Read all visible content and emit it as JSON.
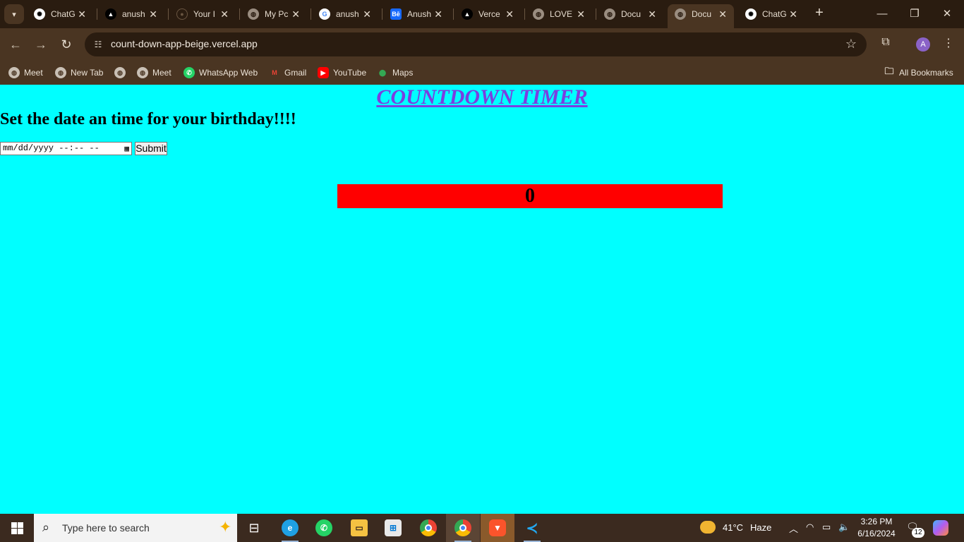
{
  "browser": {
    "tabs": [
      {
        "title": "ChatG",
        "icon": "chatgpt-icon",
        "color": "#ffffff"
      },
      {
        "title": "anush",
        "icon": "vercel-icon",
        "color": "#000000"
      },
      {
        "title": "Your I",
        "icon": "github-icon",
        "color": "#2a1c10"
      },
      {
        "title": "My Pc",
        "icon": "globe-icon",
        "color": "#9a8d80"
      },
      {
        "title": "anush",
        "icon": "google-icon",
        "color": "#ffffff"
      },
      {
        "title": "Anush",
        "icon": "behance-icon",
        "color": "#1769ff"
      },
      {
        "title": "Verce",
        "icon": "vercel-icon",
        "color": "#000000"
      },
      {
        "title": "LOVE",
        "icon": "globe-icon",
        "color": "#9a8d80"
      },
      {
        "title": "Docu",
        "icon": "globe-icon",
        "color": "#9a8d80"
      },
      {
        "title": "Docu",
        "icon": "globe-icon",
        "color": "#9a8d80"
      },
      {
        "title": "ChatG",
        "icon": "chatgpt-icon",
        "color": "#ffffff"
      }
    ],
    "active_tab_index": 9,
    "url": "count-down-app-beige.vercel.app",
    "avatar_letter": "A",
    "bookmarks": [
      {
        "label": "Meet",
        "icon": "globe-icon"
      },
      {
        "label": "New Tab",
        "icon": "globe-icon"
      },
      {
        "label": "",
        "icon": "globe-icon"
      },
      {
        "label": "Meet",
        "icon": "globe-icon"
      },
      {
        "label": "WhatsApp Web",
        "icon": "whatsapp-icon"
      },
      {
        "label": "Gmail",
        "icon": "gmail-icon"
      },
      {
        "label": "YouTube",
        "icon": "youtube-icon"
      },
      {
        "label": "Maps",
        "icon": "maps-icon"
      }
    ],
    "all_bookmarks_label": "All Bookmarks"
  },
  "page": {
    "title": "COUNTDOWN TIMER",
    "subtitle": "Set the date an time for your birthday!!!!",
    "datetime_placeholder": "mm/dd/yyyy --:-- --",
    "submit_label": "Submit",
    "counter_value": "0",
    "colors": {
      "background": "#00ffff",
      "title": "#7b3fe0",
      "counter_bg": "#ff0000"
    }
  },
  "taskbar": {
    "search_placeholder": "Type here to search",
    "weather_temp": "41°C",
    "weather_desc": "Haze",
    "time": "3:26 PM",
    "date": "6/16/2024",
    "notification_count": "12",
    "chrome_profile_letter": "A"
  }
}
